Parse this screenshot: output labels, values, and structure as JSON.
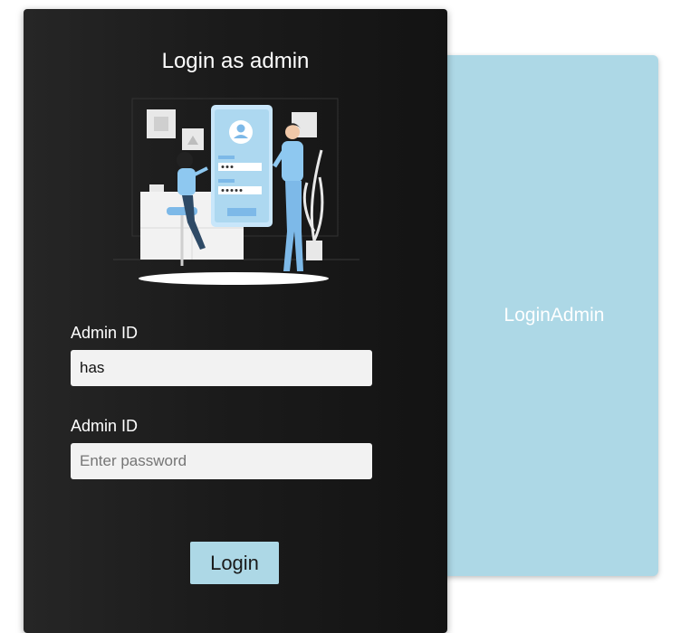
{
  "side_panel": {
    "label": "LoginAdmin"
  },
  "login_card": {
    "title": "Login as admin",
    "illustration_icon": "login-illustration-icon",
    "admin_id_label": "Admin ID",
    "admin_id_value": "has",
    "password_label": "Admin ID",
    "password_placeholder": "Enter password",
    "login_button_label": "Login"
  },
  "colors": {
    "accent": "#add8e6",
    "card_background": "#1b1b1b",
    "input_background": "#f2f2f2"
  }
}
